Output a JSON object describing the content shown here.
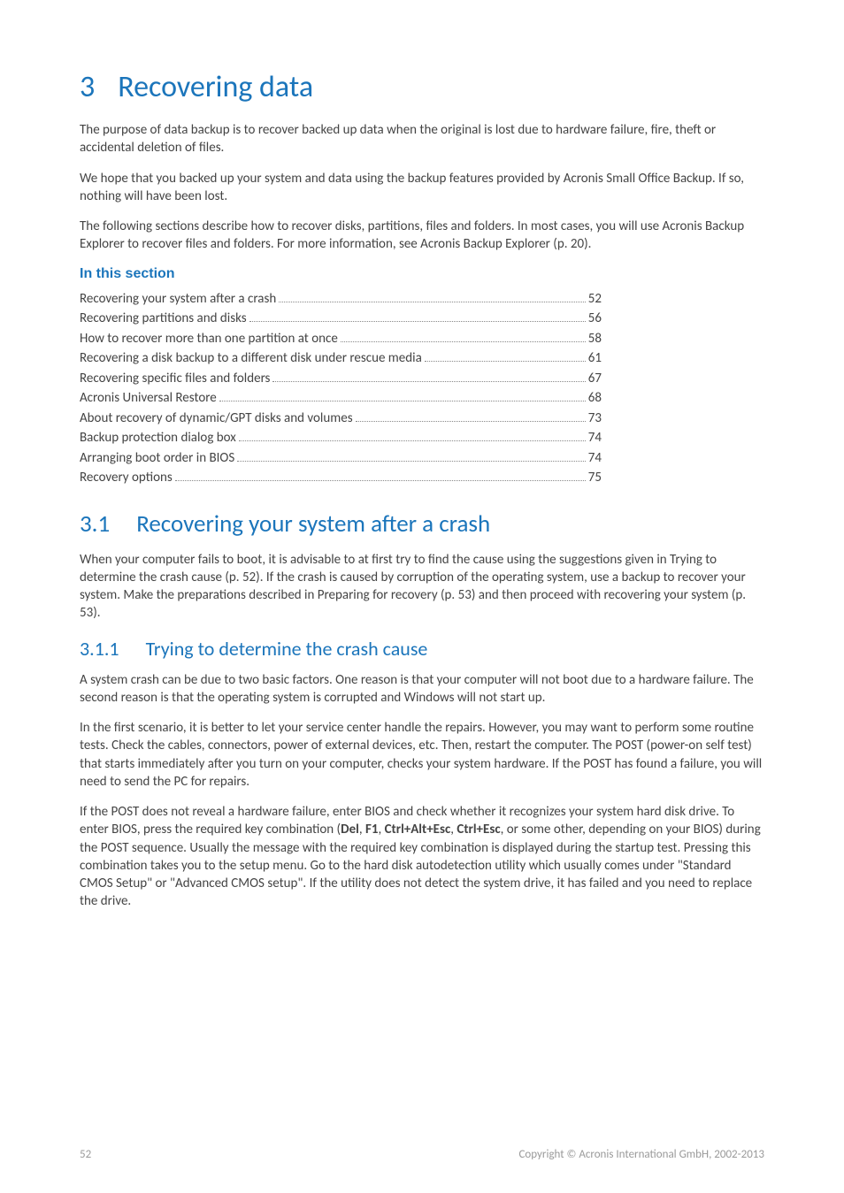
{
  "h1_num": "3",
  "h1_title": "Recovering data",
  "intro_p1": "The purpose of data backup is to recover backed up data when the original is lost due to hardware failure, fire, theft or accidental deletion of files.",
  "intro_p2": "We hope that you backed up your system and data using the backup features provided by Acronis Small Office Backup. If so, nothing will have been lost.",
  "intro_p3": "The following sections describe how to recover disks, partitions, files and folders. In most cases, you will use Acronis Backup Explorer to recover files and folders. For more information, see Acronis Backup Explorer (p. 20).",
  "section_heading": "In this section",
  "toc": [
    {
      "label": "Recovering your system after a crash",
      "page": "52"
    },
    {
      "label": "Recovering partitions and disks",
      "page": "56"
    },
    {
      "label": "How to recover more than one partition at once",
      "page": "58"
    },
    {
      "label": "Recovering a disk backup to a different disk under rescue media",
      "page": "61"
    },
    {
      "label": "Recovering specific files and folders",
      "page": "67"
    },
    {
      "label": "Acronis Universal Restore",
      "page": "68"
    },
    {
      "label": "About recovery of dynamic/GPT disks and volumes",
      "page": "73"
    },
    {
      "label": "Backup protection dialog box",
      "page": "74"
    },
    {
      "label": "Arranging boot order in BIOS",
      "page": "74"
    },
    {
      "label": "Recovery options",
      "page": "75"
    }
  ],
  "h2_num": "3.1",
  "h2_title": "Recovering your system after a crash",
  "h2_body": "When your computer fails to boot, it is advisable to at first try to find the cause using the suggestions given in Trying to determine the crash cause (p. 52). If the crash is caused by corruption of the operating system, use a backup to recover your system. Make the preparations described in Preparing for recovery (p. 53) and then proceed with recovering your system (p. 53).",
  "h3_num": "3.1.1",
  "h3_title": "Trying to determine the crash cause",
  "h3_p1": "A system crash can be due to two basic factors. One reason is that your computer will not boot due to a hardware failure. The second reason is that the operating system is corrupted and Windows will not start up.",
  "h3_p2": "In the first scenario, it is better to let your service center handle the repairs. However, you may want to perform some routine tests. Check the cables, connectors, power of external devices, etc. Then, restart the computer. The POST (power-on self test) that starts immediately after you turn on your computer, checks your system hardware. If the POST has found a failure, you will need to send the PC for repairs.",
  "h3_p3_pre": "If the POST does not reveal a hardware failure, enter BIOS and check whether it recognizes your system hard disk drive. To enter BIOS, press the required key combination (",
  "h3_p3_k1": "Del",
  "h3_p3_sep1": ", ",
  "h3_p3_k2": "F1",
  "h3_p3_sep2": ", ",
  "h3_p3_k3": "Ctrl+Alt+Esc",
  "h3_p3_sep3": ", ",
  "h3_p3_k4": "Ctrl+Esc",
  "h3_p3_post": ", or some other, depending on your BIOS) during the POST sequence. Usually the message with the required key combination is displayed during the startup test. Pressing this combination takes you to the setup menu. Go to the hard disk autodetection utility which usually comes under \"Standard CMOS Setup\" or \"Advanced CMOS setup\". If the utility does not detect the system drive, it has failed and you need to replace the drive.",
  "footer_page": "52",
  "footer_copyright": "Copyright © Acronis International GmbH, 2002-2013"
}
